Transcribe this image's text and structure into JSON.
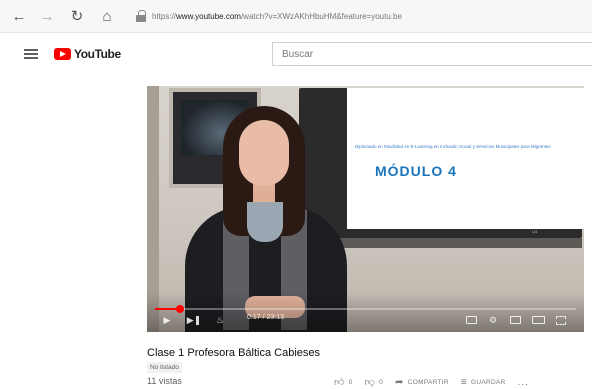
{
  "browser": {
    "url_prefix": "https://",
    "url_host": "www.youtube.com",
    "url_path": "/watch?v=XWzAKhHbuHM&feature=youtu.be",
    "icons": [
      "arrow-left-icon",
      "arrow-right-icon",
      "reload-icon",
      "home-icon",
      "lock-icon"
    ]
  },
  "header": {
    "logo_text": "YouTube",
    "search_placeholder": "Buscar"
  },
  "video": {
    "slide_text": "Diplomado en Movilidad en E-Learning en Inclusión Social y Servicios Municipales para Migrantes",
    "slide_title": "MÓDULO 4",
    "tv_brand": "LG",
    "progress": 0.06,
    "time": "0:17 / 23:13",
    "accent": "#ff0000",
    "controls": [
      "play-icon",
      "next-icon",
      "volume-icon",
      "subtitles-icon",
      "settings-icon",
      "miniplayer-icon",
      "theater-icon",
      "fullscreen-icon"
    ]
  },
  "info": {
    "title": "Clase 1 Profesora Báltica Cabieses",
    "badge": "No listado",
    "views": "11 vistas",
    "likes": "0",
    "dislikes": "0",
    "share": "COMPARTIR",
    "save": "GUARDAR",
    "more": "..."
  }
}
